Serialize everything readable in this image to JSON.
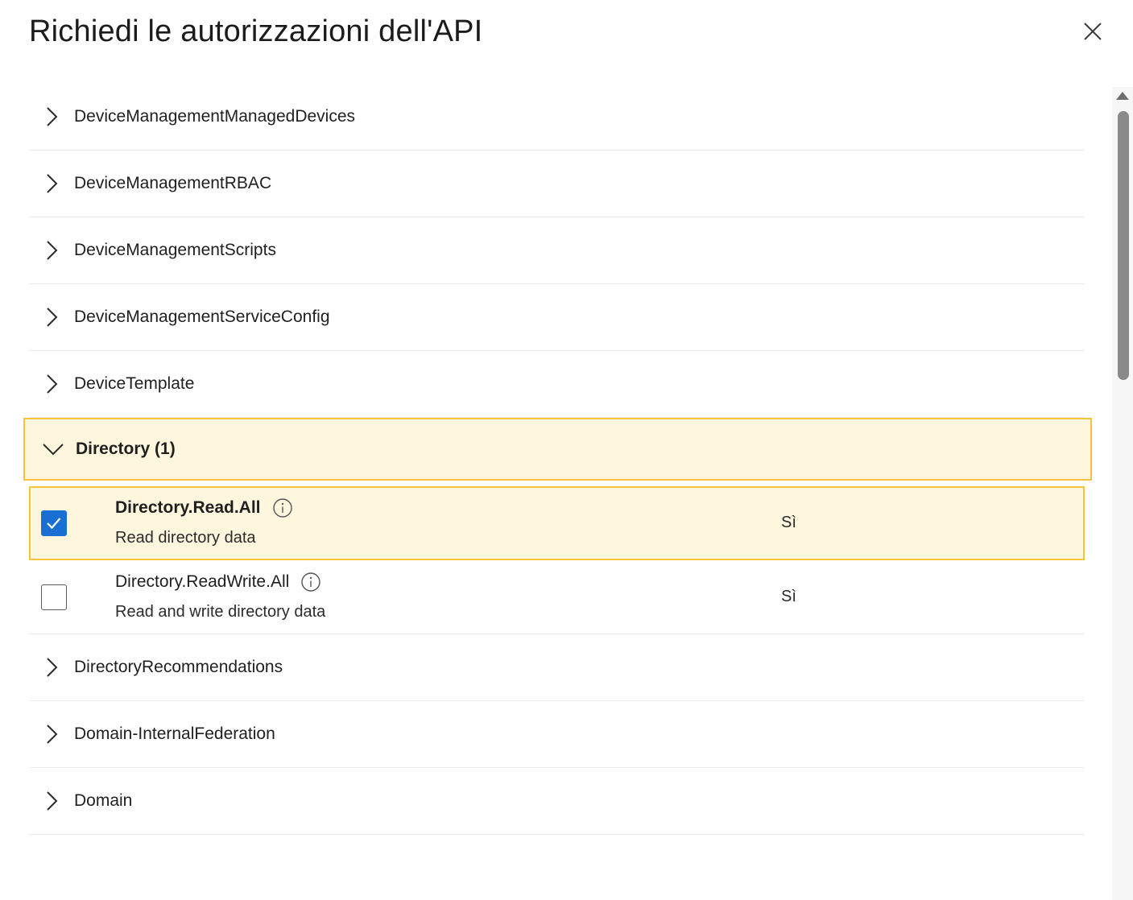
{
  "dialog": {
    "title": "Richiedi le autorizzazioni dell'API",
    "close_icon": "close-icon"
  },
  "groups_before": [
    {
      "label": "DeviceManagementManagedDevices",
      "icon": "chevron-right-icon"
    },
    {
      "label": "DeviceManagementRBAC",
      "icon": "chevron-right-icon"
    },
    {
      "label": "DeviceManagementScripts",
      "icon": "chevron-right-icon"
    },
    {
      "label": "DeviceManagementServiceConfig",
      "icon": "chevron-right-icon"
    },
    {
      "label": "DeviceTemplate",
      "icon": "chevron-right-icon"
    }
  ],
  "expanded_group": {
    "label": "Directory (1)",
    "icon": "chevron-down-icon",
    "permissions": [
      {
        "name": "Directory.Read.All",
        "description": "Read directory data",
        "admin_consent": "Sì",
        "checked": true
      },
      {
        "name": "Directory.ReadWrite.All",
        "description": "Read and write directory data",
        "admin_consent": "Sì",
        "checked": false
      }
    ]
  },
  "groups_after": [
    {
      "label": "DirectoryRecommendations",
      "icon": "chevron-right-icon"
    },
    {
      "label": "Domain-InternalFederation",
      "icon": "chevron-right-icon"
    },
    {
      "label": "Domain",
      "icon": "chevron-right-icon"
    }
  ],
  "colors": {
    "highlight_bg": "#fff6de",
    "highlight_border": "#f5c43a",
    "checkbox_checked": "#1a6fd3"
  }
}
